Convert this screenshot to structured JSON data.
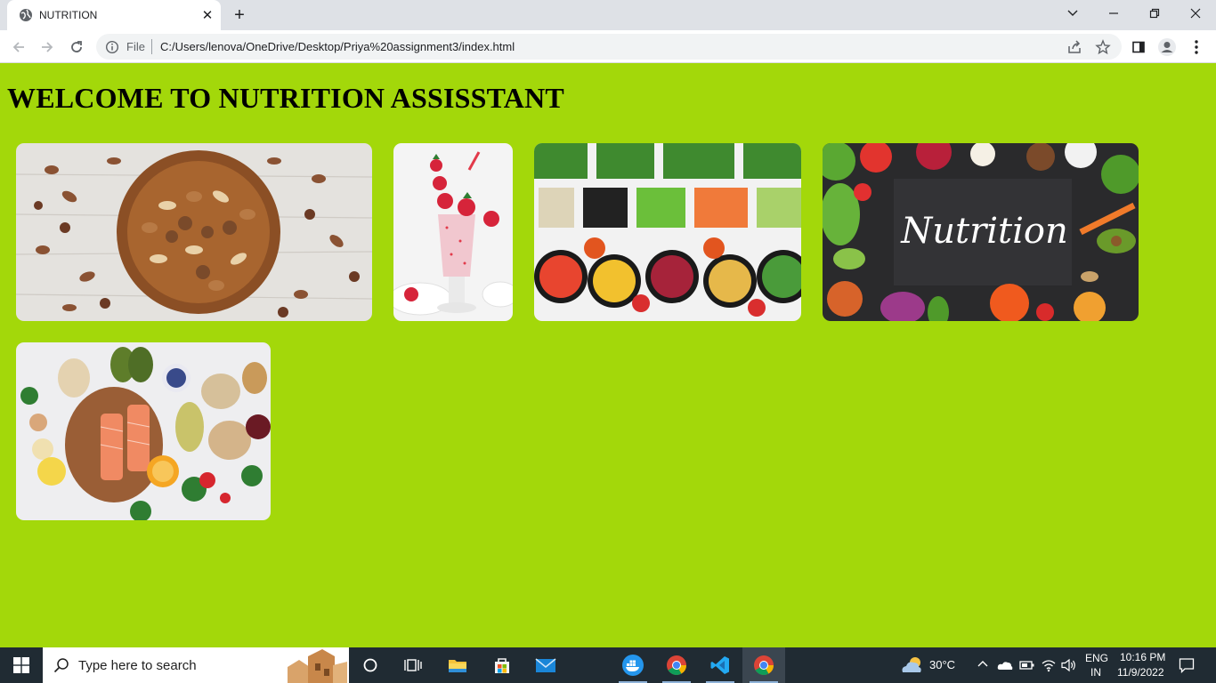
{
  "browser": {
    "tab_title": "NUTRITION",
    "tab_close_icon": "close-icon",
    "new_tab_icon": "plus-icon",
    "address": {
      "scheme_label": "File",
      "url": "C:/Users/lenova/OneDrive/Desktop/Priya%20assignment3/index.html"
    }
  },
  "page": {
    "title": "WELCOME TO NUTRITION ASSISSTANT",
    "background_color": "#a3d80a",
    "images": [
      {
        "name": "mixed-nuts-bowl-image"
      },
      {
        "name": "strawberry-milkshake-image"
      },
      {
        "name": "salad-bar-vegetables-image"
      },
      {
        "name": "nutrition-board-image",
        "text": "Nutrition"
      },
      {
        "name": "healthy-foods-spread-image"
      }
    ]
  },
  "taskbar": {
    "search_placeholder": "Type here to search",
    "weather": "30°C",
    "language": "ENG",
    "region": "IN",
    "time": "10:16 PM",
    "date": "11/9/2022"
  }
}
